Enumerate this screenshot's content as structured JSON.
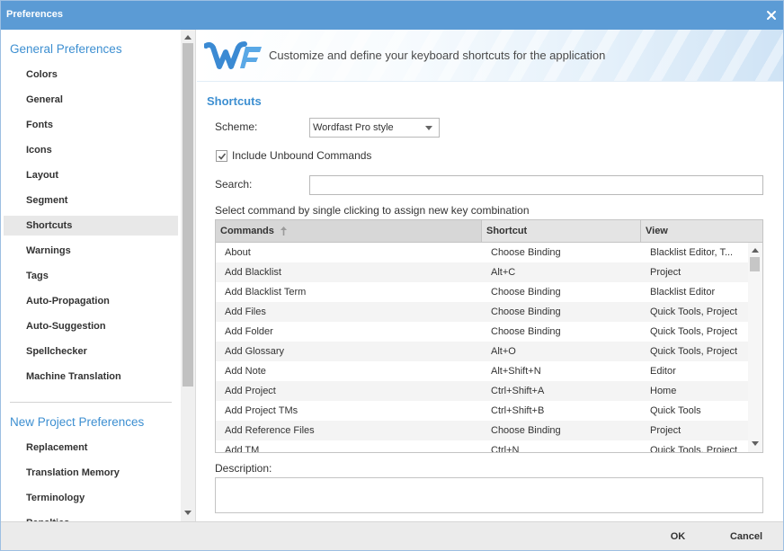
{
  "window": {
    "title": "Preferences",
    "close_icon": "close-icon"
  },
  "sidebar": {
    "groups": [
      {
        "heading": "General Preferences",
        "items": [
          {
            "label": "Colors"
          },
          {
            "label": "General"
          },
          {
            "label": "Fonts"
          },
          {
            "label": "Icons"
          },
          {
            "label": "Layout"
          },
          {
            "label": "Segment"
          },
          {
            "label": "Shortcuts",
            "selected": true
          },
          {
            "label": "Warnings"
          },
          {
            "label": "Tags"
          },
          {
            "label": "Auto-Propagation"
          },
          {
            "label": "Auto-Suggestion"
          },
          {
            "label": "Spellchecker"
          },
          {
            "label": "Machine Translation"
          }
        ]
      },
      {
        "heading": "New Project Preferences",
        "items": [
          {
            "label": "Replacement"
          },
          {
            "label": "Translation Memory"
          },
          {
            "label": "Terminology"
          },
          {
            "label": "Penalties"
          }
        ]
      }
    ]
  },
  "banner": {
    "logo": "wordfast-logo",
    "text": "Customize and define your keyboard shortcuts for the application"
  },
  "main": {
    "section_title": "Shortcuts",
    "scheme": {
      "label": "Scheme:",
      "value": "Wordfast Pro style",
      "icon": "chevron-down-icon"
    },
    "include_unbound": {
      "label": "Include Unbound Commands",
      "checked": true,
      "icon": "checkmark-icon"
    },
    "search": {
      "label": "Search:",
      "value": ""
    },
    "instruction": "Select command by single clicking to assign new key combination",
    "table": {
      "columns": {
        "command": "Commands",
        "shortcut": "Shortcut",
        "view": "View"
      },
      "sort_icon": "sort-ascending-icon",
      "rows": [
        {
          "command": "About",
          "shortcut": "Choose Binding",
          "view": "Blacklist Editor, T..."
        },
        {
          "command": "Add Blacklist",
          "shortcut": "Alt+C",
          "view": "Project"
        },
        {
          "command": "Add Blacklist Term",
          "shortcut": "Choose Binding",
          "view": "Blacklist Editor"
        },
        {
          "command": "Add Files",
          "shortcut": "Choose Binding",
          "view": "Quick Tools, Project"
        },
        {
          "command": "Add Folder",
          "shortcut": "Choose Binding",
          "view": "Quick Tools, Project"
        },
        {
          "command": "Add Glossary",
          "shortcut": "Alt+O",
          "view": "Quick Tools, Project"
        },
        {
          "command": "Add Note",
          "shortcut": "Alt+Shift+N",
          "view": "Editor"
        },
        {
          "command": "Add Project",
          "shortcut": "Ctrl+Shift+A",
          "view": "Home"
        },
        {
          "command": "Add Project TMs",
          "shortcut": "Ctrl+Shift+B",
          "view": "Quick Tools"
        },
        {
          "command": "Add Reference Files",
          "shortcut": "Choose Binding",
          "view": "Project"
        },
        {
          "command": "Add TM",
          "shortcut": "Ctrl+N",
          "view": "Quick Tools, Project"
        }
      ]
    },
    "description": {
      "label": "Description:",
      "value": ""
    }
  },
  "footer": {
    "ok": "OK",
    "cancel": "Cancel"
  },
  "colors": {
    "accent": "#5b9bd5",
    "heading": "#3d8fd1",
    "selected": "#e8e8e8"
  }
}
